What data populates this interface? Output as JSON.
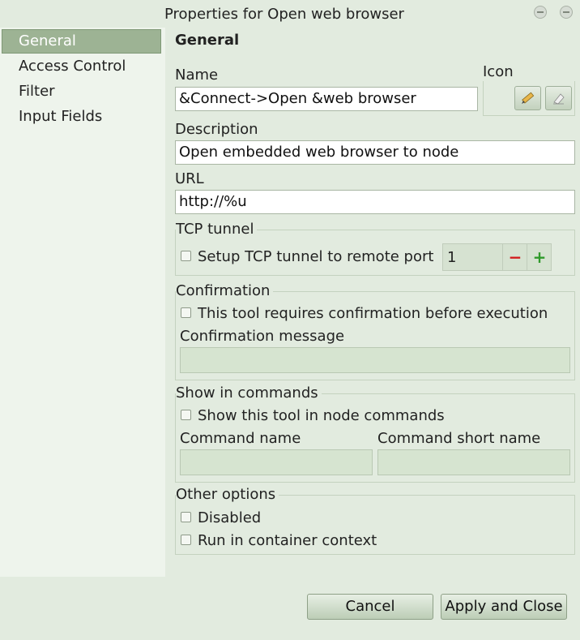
{
  "window": {
    "title": "Properties for Open web browser"
  },
  "sidebar": {
    "items": [
      {
        "label": "General",
        "selected": true
      },
      {
        "label": "Access Control",
        "selected": false
      },
      {
        "label": "Filter",
        "selected": false
      },
      {
        "label": "Input Fields",
        "selected": false
      }
    ]
  },
  "general": {
    "heading": "General",
    "name_label": "Name",
    "name_value": "&Connect->Open &web browser",
    "icon_label": "Icon",
    "description_label": "Description",
    "description_value": "Open embedded web browser to node",
    "url_label": "URL",
    "url_value": "http://%u",
    "tcp_tunnel": {
      "title": "TCP tunnel",
      "checkbox_label": "Setup TCP tunnel to remote port",
      "checked": false,
      "port_value": "1",
      "decrement": "−",
      "increment": "+"
    },
    "confirmation": {
      "title": "Confirmation",
      "checkbox_label": "This tool requires confirmation before execution",
      "checked": false,
      "message_label": "Confirmation message",
      "message_value": ""
    },
    "show_in_commands": {
      "title": "Show in commands",
      "checkbox_label": "Show this tool in node commands",
      "checked": false,
      "command_name_label": "Command name",
      "command_name_value": "",
      "command_short_label": "Command short name",
      "command_short_value": ""
    },
    "other_options": {
      "title": "Other options",
      "disabled_label": "Disabled",
      "disabled_checked": false,
      "container_label": "Run in container context",
      "container_checked": false
    }
  },
  "footer": {
    "cancel_label": "Cancel",
    "apply_label": "Apply and Close"
  },
  "colors": {
    "background": "#e2ebdf",
    "selected_item": "#9db394",
    "minus": "#d21a1a",
    "plus": "#2f9a2a"
  }
}
